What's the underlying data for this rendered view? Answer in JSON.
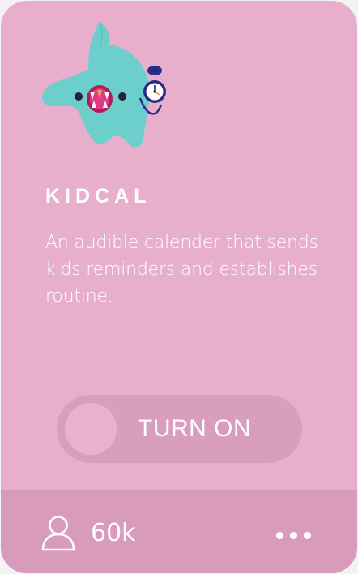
{
  "app": {
    "title": "KIDCAL",
    "description": "An audible calender that sends kids reminders and establishes routine.",
    "mascot_icon": "kidcal-monster-with-stopwatch-icon"
  },
  "toggle": {
    "label": "TURN ON",
    "state": "off"
  },
  "footer": {
    "user_count": "60k",
    "user_icon": "user-icon",
    "more_icon": "more-dots-icon"
  },
  "colors": {
    "card_background": "#e8afcd",
    "footer_background": "#d89bbb",
    "toggle_track": "#d99dbd",
    "toggle_knob": "#eab1cf",
    "text": "#ffffff",
    "mascot_body": "#6ccfcb"
  }
}
